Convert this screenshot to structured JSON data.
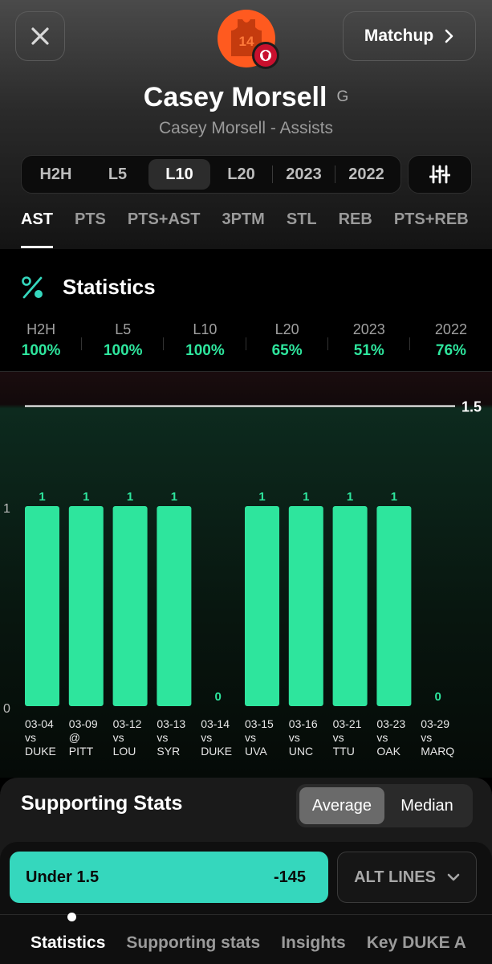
{
  "header": {
    "matchup_label": "Matchup",
    "jersey_number": "14",
    "player_name": "Casey Morsell",
    "position": "G",
    "subtitle": "Casey Morsell - Assists"
  },
  "ranges": [
    "H2H",
    "L5",
    "L10",
    "L20",
    "2023",
    "2022"
  ],
  "active_range": "L10",
  "stat_tabs": [
    "AST",
    "PTS",
    "PTS+AST",
    "3PTM",
    "STL",
    "REB",
    "PTS+REB"
  ],
  "active_stat": "AST",
  "statistics": {
    "title": "Statistics",
    "hit_rates": [
      {
        "label": "H2H",
        "value": "100%"
      },
      {
        "label": "L5",
        "value": "100%"
      },
      {
        "label": "L10",
        "value": "100%"
      },
      {
        "label": "L20",
        "value": "65%"
      },
      {
        "label": "2023",
        "value": "51%"
      },
      {
        "label": "2022",
        "value": "76%"
      }
    ]
  },
  "chart_data": {
    "type": "bar",
    "categories": [
      "03-04 vs DUKE",
      "03-09 @ PITT",
      "03-12 vs LOU",
      "03-13 vs SYR",
      "03-14 vs DUKE",
      "03-15 vs UVA",
      "03-16 vs UNC",
      "03-21 vs TTU",
      "03-23 vs OAK",
      "03-29 vs MARQ"
    ],
    "games": [
      {
        "date": "03-04",
        "loc": "vs",
        "opp": "DUKE",
        "value": 1
      },
      {
        "date": "03-09",
        "loc": "@",
        "opp": "PITT",
        "value": 1
      },
      {
        "date": "03-12",
        "loc": "vs",
        "opp": "LOU",
        "value": 1
      },
      {
        "date": "03-13",
        "loc": "vs",
        "opp": "SYR",
        "value": 1
      },
      {
        "date": "03-14",
        "loc": "vs",
        "opp": "DUKE",
        "value": 0
      },
      {
        "date": "03-15",
        "loc": "vs",
        "opp": "UVA",
        "value": 1
      },
      {
        "date": "03-16",
        "loc": "vs",
        "opp": "UNC",
        "value": 1
      },
      {
        "date": "03-21",
        "loc": "vs",
        "opp": "TTU",
        "value": 1
      },
      {
        "date": "03-23",
        "loc": "vs",
        "opp": "OAK",
        "value": 1
      },
      {
        "date": "03-29",
        "loc": "vs",
        "opp": "MARQ",
        "value": 0
      }
    ],
    "values": [
      1,
      1,
      1,
      1,
      0,
      1,
      1,
      1,
      1,
      0
    ],
    "line": 1.5,
    "line_label": "1.5",
    "yticks": [
      0,
      1
    ],
    "ylim": [
      0,
      1.5
    ],
    "bar_color": "#2ee59d"
  },
  "supporting": {
    "title": "Supporting Stats",
    "toggle": [
      "Average",
      "Median"
    ],
    "active_toggle": "Average"
  },
  "bet": {
    "under_label": "Under 1.5",
    "under_odds": "-145",
    "alt_lines_label": "ALT LINES"
  },
  "bottom_tabs": [
    "Statistics",
    "Supporting stats",
    "Insights",
    "Key DUKE A"
  ],
  "active_bottom_tab": "Statistics",
  "colors": {
    "accent": "#2ee59d",
    "avatar": "#ff5a1f",
    "under_button": "#35d7bd"
  }
}
